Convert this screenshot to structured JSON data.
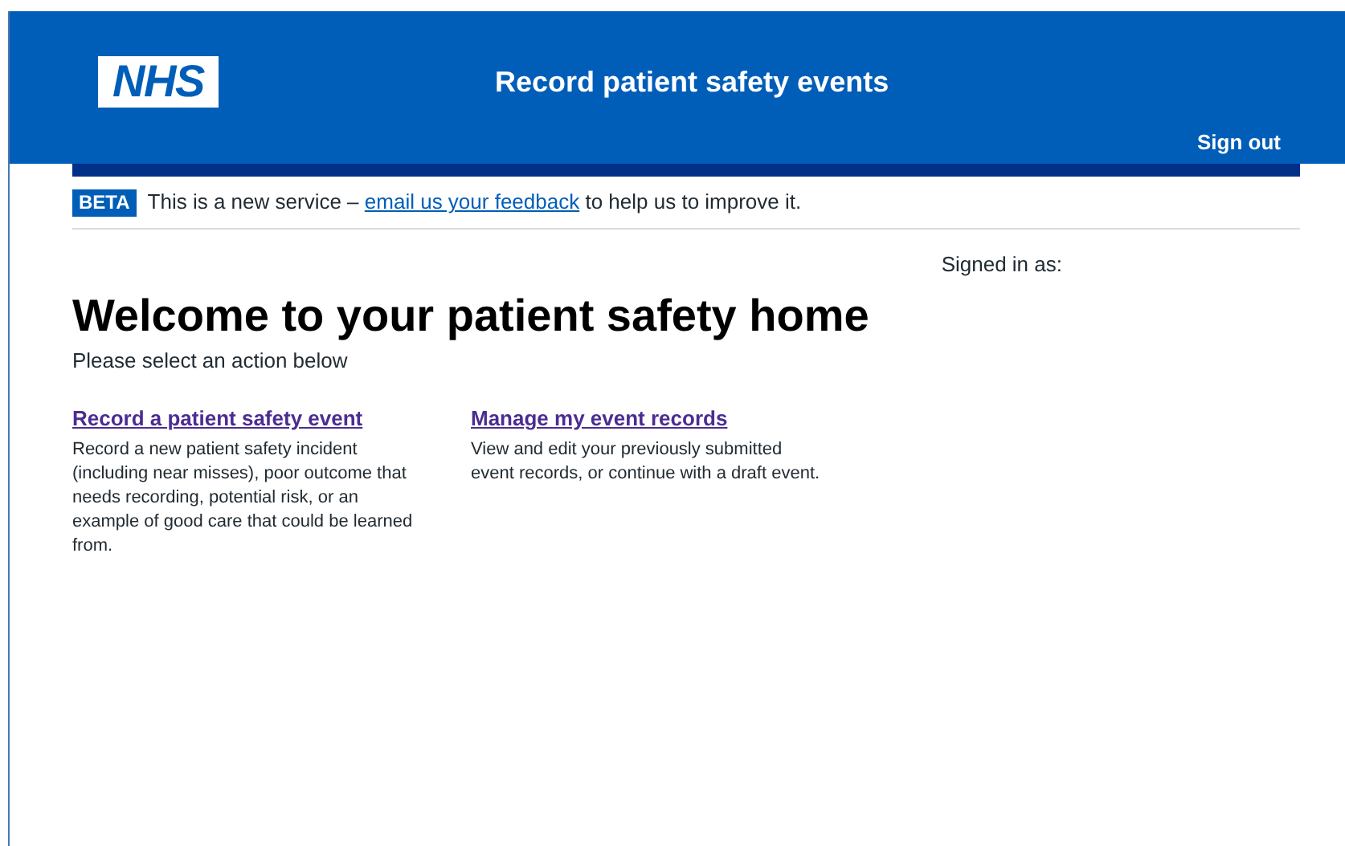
{
  "header": {
    "logo": "NHS",
    "title": "Record patient safety events",
    "sign_out": "Sign out"
  },
  "beta_banner": {
    "tag": "BETA",
    "before": "This is a new service –",
    "link": "email us your feedback",
    "after": "to help us to improve it."
  },
  "signed_in": "Signed in as:",
  "heading": "Welcome to your patient safety home",
  "intro": "Please select an action below",
  "actions": [
    {
      "title": "Record a patient safety event",
      "description": "Record a new patient safety incident (including near misses), poor outcome that needs recording, potential risk, or an example of good care that could be learned from."
    },
    {
      "title": "Manage my event records",
      "description": "View and edit your previously submitted event records, or continue with a draft event."
    }
  ]
}
